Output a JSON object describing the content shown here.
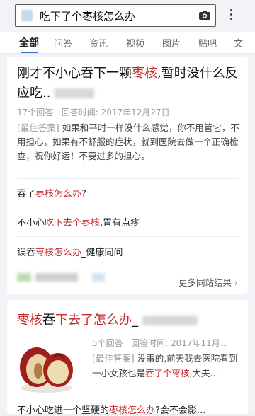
{
  "search": {
    "query": "吃下了个枣核怎么办"
  },
  "tabs": [
    "全部",
    "问答",
    "资讯",
    "视频",
    "图片",
    "贴吧",
    "文"
  ],
  "result1": {
    "title_a": "刚才不小心吞下一颗",
    "title_hl": "枣核",
    "title_b": ",暂时没什么反应吃..",
    "answers_count": "17个回答",
    "answer_time": "回答时间: 2017年12月27日",
    "best_tag": "[最佳答案]",
    "best_text": "如果和平时一样没什么感觉，你不用管它，不用担心，如果有不舒服的症状，就到医院去做一个正确检查，祝你好运！不要过多的担心。",
    "related": [
      {
        "pre": "吞了",
        "hl": "枣核怎么办",
        "post": "?"
      },
      {
        "pre": "不小心",
        "hl": "吃下去个枣核",
        "post": ",胃有点疼"
      },
      {
        "pre": "误吞",
        "hl": "枣核怎么办",
        "post": "_健康同问"
      }
    ],
    "more_label": "更多同站结果"
  },
  "result2": {
    "title_hl1": "枣核",
    "title_mid": "吞",
    "title_hl2": "下去了怎么办",
    "title_post": "_",
    "answers_count": "5个回答",
    "answer_time": "回答时间: 2017年11月...",
    "best_tag": "[最佳答案]",
    "best_a": "没事的,前天我去医院看到一小女孩也是",
    "best_hl": "吞了个枣核",
    "best_b": ",大夫...",
    "related_pre": "不小心吃进一个坚硬的",
    "related_hl": "枣核怎么办",
    "related_post": "?会不会影..."
  },
  "colors": {
    "highlight": "#c62828",
    "tab_active": "#3b6fd6"
  }
}
